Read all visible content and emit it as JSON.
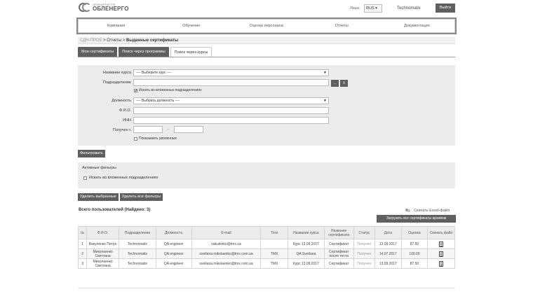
{
  "header": {
    "logo_sub": "ПРИКАРПАТТЯ",
    "logo_main": "ОБЛЕНЕРГО",
    "lang_label": "Язык:",
    "lang_value": "RUS",
    "user": "Technomatix",
    "logout": "Выйти"
  },
  "nav": [
    "Компания",
    "Обучение",
    "Оценка персонала",
    "Отчеты",
    "Документация"
  ],
  "breadcrumb": {
    "root": "СДН-ПРОЕ",
    "sep1": " > ",
    "reports": "Отчеты",
    "sep2": " > ",
    "current": "Выданные сертификаты"
  },
  "tabs": [
    "Мои сертификаты",
    "Поиск через программы",
    "Поиск через курсы"
  ],
  "filter": {
    "course_label": "Название курса",
    "course_value": "---- Выберите курс ----",
    "dept_label": "Подразделение",
    "dept_btn1": "...",
    "dept_btn2": "X",
    "nested_label": "Искать во вложенных подразделениях",
    "position_label": "Должность",
    "position_value": "---- Выбрать должность ----",
    "fio_label": "Ф.И.О.",
    "inn_label": "ИНН",
    "received_label": "Получен с",
    "dash": "-",
    "fired_label": "Показывать уволенных"
  },
  "filter_button": "Фильтровать",
  "active_filters": {
    "title": "Активные фильтры",
    "item": "Искать во вложенных подразделениях"
  },
  "actions": [
    "Удалить выбранные",
    "Удалить все фильтры"
  ],
  "total": "Всего пользователей (Найдено: 3)",
  "excel": "Скачать Excel-файл",
  "archive_button": "Загрузить все сертификаты архивом",
  "table": {
    "headers": [
      "№",
      "Ф.И.О.",
      "Подразделение",
      "Должность",
      "E-mail",
      "Теги",
      "Название курса",
      "Название сертификата",
      "Статус",
      "Дата",
      "Оценка",
      "Скачать файл"
    ],
    "rows": [
      {
        "n": "1",
        "name": "Вакуленко Петро",
        "dept": "Technomatix",
        "position": "QA engineer",
        "email": "vakulenko@tmx.ua",
        "tags": "",
        "course": "Курс 13.09.2017",
        "cert": "Сертификат",
        "status": "Получен",
        "date": "13.09.2017",
        "score": "87.50"
      },
      {
        "n": "2",
        "name": "Миколаенко Светлана",
        "dept": "Technomatix",
        "position": "QA engineer",
        "email": "svetlana.mikolaenko@tmx.com.ua",
        "tags": "TMX",
        "course": "QA Svetlana",
        "cert": "Сертификат после теста",
        "status": "Получен",
        "date": "14.07.2017",
        "score": "100.00"
      },
      {
        "n": "3",
        "name": "Миколаенко Светлана",
        "dept": "Technomatix",
        "position": "QA engineer",
        "email": "svetlana.mikolaenko@tmx.com.ua",
        "tags": "TMX",
        "course": "Курс 13.09.2017",
        "cert": "Сертификат",
        "status": "Получен",
        "date": "13.09.2017",
        "score": "87.50"
      }
    ]
  }
}
